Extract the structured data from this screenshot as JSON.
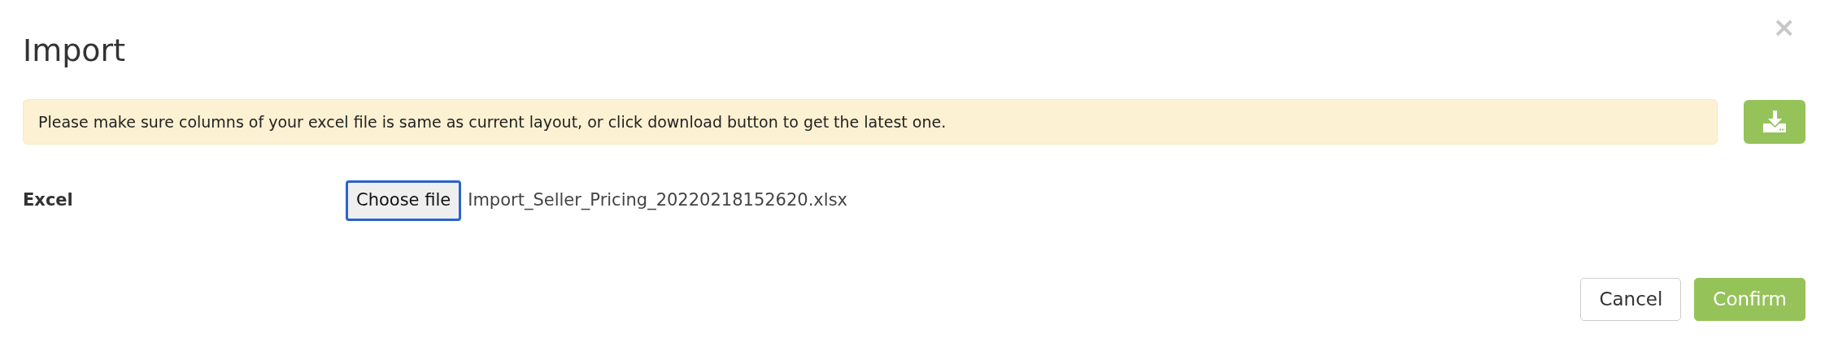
{
  "dialog": {
    "title": "Import",
    "close": "×"
  },
  "notice": {
    "text": "Please make sure columns of your excel file is same as current layout, or click download button to get the latest one."
  },
  "field": {
    "label": "Excel",
    "button": "Choose file",
    "file_name": "Import_Seller_Pricing_20220218152620.xlsx",
    "focused": true
  },
  "buttons": [
    {
      "label": "Cancel",
      "kind": "secondary"
    },
    {
      "label": "Confirm",
      "kind": "primary"
    }
  ]
}
